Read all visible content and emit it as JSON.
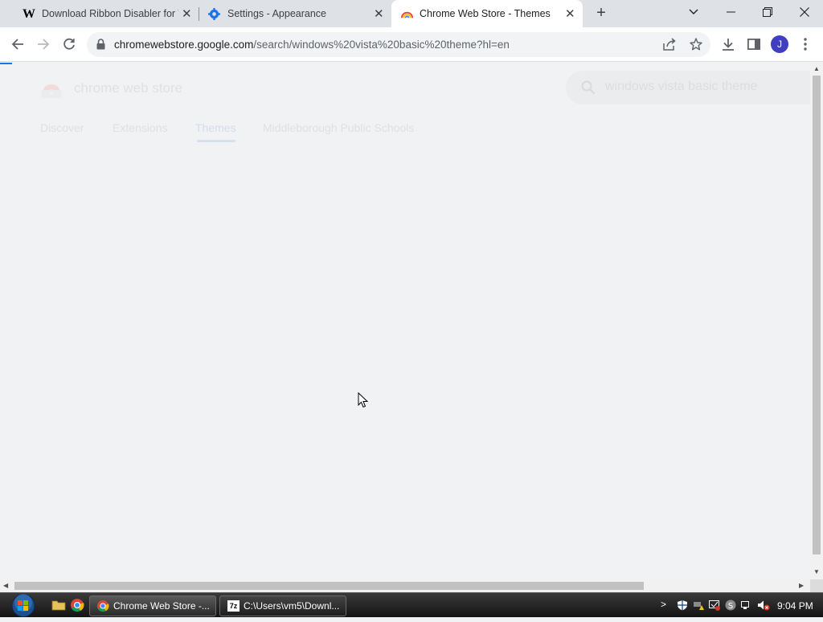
{
  "browser": {
    "tabs": [
      {
        "title": "Download Ribbon Disabler for W",
        "favicon": "w-icon"
      },
      {
        "title": "Settings - Appearance",
        "favicon": "gear-icon"
      },
      {
        "title": "Chrome Web Store - Themes",
        "favicon": "rainbow-icon",
        "active": true
      }
    ],
    "url": {
      "host": "chromewebstore.google.com",
      "path": "/search/windows%20vista%20basic%20theme?hl=en"
    },
    "profile_initial": "J",
    "accent": "#1a73e8"
  },
  "page": {
    "store_name": "chrome web store",
    "search_query": "windows vista basic theme",
    "nav": [
      "Discover",
      "Extensions",
      "Themes",
      "Middleborough Public Schools"
    ],
    "selected_nav": "Themes"
  },
  "taskbar": {
    "tasks": [
      {
        "label": "Chrome Web Store -...",
        "icon": "chrome-icon"
      },
      {
        "label": "C:\\Users\\vm5\\Downl...",
        "icon": "7zip-icon"
      }
    ],
    "clock": "9:04 PM"
  }
}
